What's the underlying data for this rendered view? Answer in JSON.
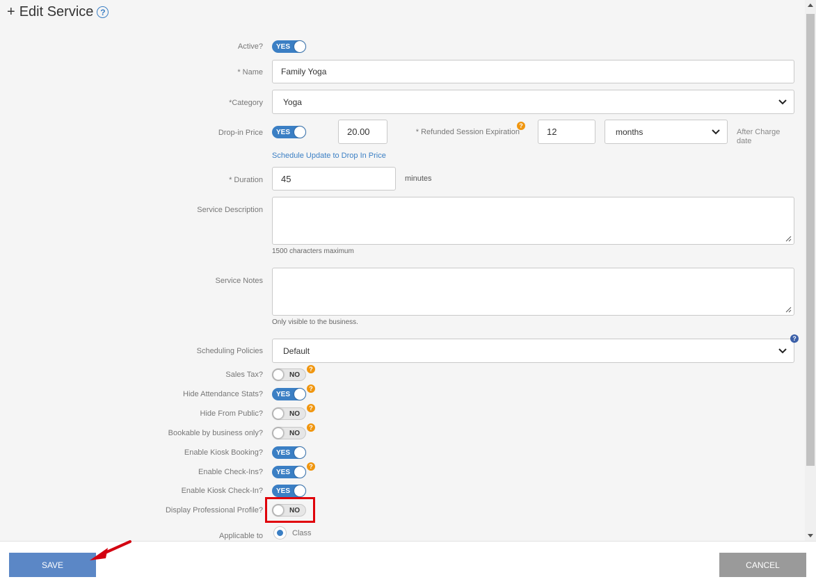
{
  "header": {
    "plus": "+",
    "title": "Edit Service",
    "help": "?"
  },
  "form": {
    "active": {
      "label": "Active?",
      "state": "YES"
    },
    "name": {
      "label": "* Name",
      "value": "Family Yoga"
    },
    "category": {
      "label": "*Category",
      "value": "Yoga"
    },
    "dropin": {
      "label": "Drop-in Price",
      "state": "YES",
      "price": "20.00",
      "schedule_link": "Schedule Update to Drop In Price"
    },
    "refund": {
      "label": "* Refunded Session Expiration",
      "value": "12",
      "unit": "months",
      "suffix": "After Charge date"
    },
    "duration": {
      "label": "* Duration",
      "value": "45",
      "unit": "minutes"
    },
    "description": {
      "label": "Service Description",
      "hint": "1500 characters maximum"
    },
    "notes": {
      "label": "Service Notes",
      "hint": "Only visible to the business."
    },
    "policies": {
      "label": "Scheduling Policies",
      "value": "Default"
    },
    "toggles": [
      {
        "label": "Sales Tax?",
        "state": "NO"
      },
      {
        "label": "Hide Attendance Stats?",
        "state": "YES"
      },
      {
        "label": "Hide From Public?",
        "state": "NO"
      },
      {
        "label": "Bookable by business only?",
        "state": "NO"
      },
      {
        "label": "Enable Kiosk Booking?",
        "state": "YES"
      },
      {
        "label": "Enable Check-Ins?",
        "state": "YES"
      },
      {
        "label": "Enable Kiosk Check-In?",
        "state": "YES"
      },
      {
        "label": "Display Professional Profile?",
        "state": "NO"
      }
    ],
    "applicable": {
      "label": "Applicable to",
      "option": "Class"
    }
  },
  "footer": {
    "save": "SAVE",
    "cancel": "CANCEL"
  },
  "colors": {
    "accent": "#3b7fc4",
    "warning": "#f0960f",
    "highlight": "#e0000a"
  }
}
